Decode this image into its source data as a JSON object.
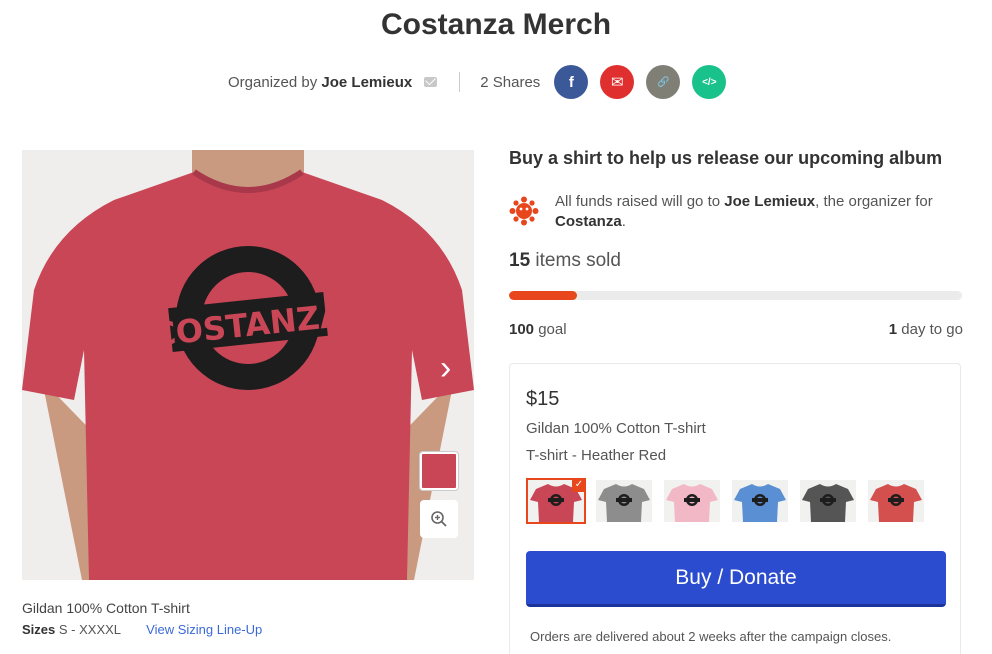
{
  "title": "Costanza Merch",
  "meta": {
    "organized_by_prefix": "Organized by",
    "organizer": "Joe Lemieux",
    "shares": "2 Shares",
    "share_buttons": [
      {
        "name": "facebook-share-button",
        "icon": "facebook-icon",
        "glyph": "f",
        "color": "#3b5998"
      },
      {
        "name": "email-share-button",
        "icon": "email-icon",
        "glyph": "✉",
        "color": "#e02f2f"
      },
      {
        "name": "link-share-button",
        "icon": "link-icon",
        "glyph": "🔗",
        "color": "#7f7f76"
      },
      {
        "name": "embed-share-button",
        "icon": "embed-icon",
        "glyph": "</>",
        "color": "#19c28a"
      }
    ]
  },
  "product_image": {
    "logo_text": "COSTANZA",
    "shirt_color": "#c94656"
  },
  "caption": {
    "item": "Gildan 100% Cotton T-shirt",
    "sizes_label": "Sizes",
    "sizes_value": "S - XXXXL",
    "sizing_link": "View Sizing Line-Up"
  },
  "campaign": {
    "headline": "Buy a shirt to help us release our upcoming album",
    "funds_prefix": "All funds raised will go to",
    "funds_recipient": "Joe Lemieux",
    "funds_middle": ", the organizer for",
    "funds_campaign": "Costanza",
    "funds_suffix": ".",
    "sold_count": "15",
    "sold_label": "items sold",
    "progress_fraction": 0.15,
    "goal_value": "100",
    "goal_label": "goal",
    "time_value": "1",
    "time_label": "day to go"
  },
  "card": {
    "price": "$15",
    "item_name": "Gildan 100% Cotton T-shirt",
    "variant": "T-shirt - Heather Red",
    "swatches": [
      {
        "color": "#c94656",
        "selected": true
      },
      {
        "color": "#8d8d8d",
        "selected": false
      },
      {
        "color": "#f2b8c6",
        "selected": false
      },
      {
        "color": "#5b8fd3",
        "selected": false
      },
      {
        "color": "#555555",
        "selected": false
      },
      {
        "color": "#d3504e",
        "selected": false
      }
    ],
    "check_glyph": "✓",
    "buy_label": "Buy / Donate",
    "delivery_note": "Orders are delivered about 2 weeks after the campaign closes."
  },
  "colors": {
    "accent": "#e8461c",
    "button": "#2b4ccf",
    "link": "#3a6ad8"
  }
}
